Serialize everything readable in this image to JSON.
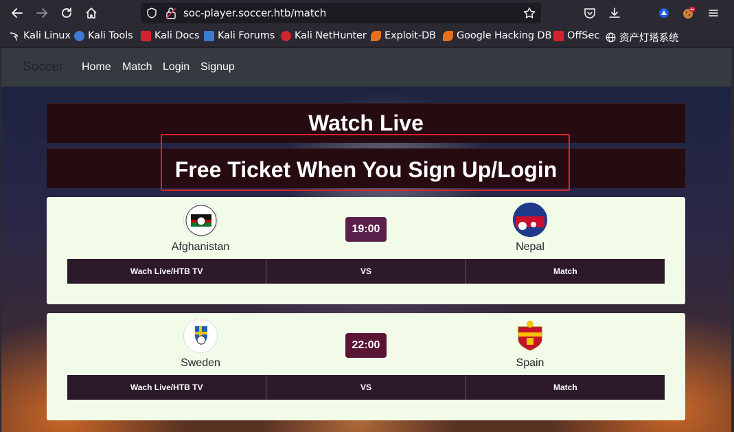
{
  "browser": {
    "url": "soc-player.soccer.htb/match",
    "bookmarks": [
      {
        "label": "Kali Linux",
        "icon": "kali-dragon-icon"
      },
      {
        "label": "Kali Tools",
        "icon": "kali-tools-icon"
      },
      {
        "label": "Kali Docs",
        "icon": "kali-docs-icon"
      },
      {
        "label": "Kali Forums",
        "icon": "kali-forums-icon"
      },
      {
        "label": "Kali NetHunter",
        "icon": "nethunter-icon"
      },
      {
        "label": "Exploit-DB",
        "icon": "exploit-db-icon"
      },
      {
        "label": "Google Hacking DB",
        "icon": "ghdb-icon"
      },
      {
        "label": "OffSec",
        "icon": "offsec-icon"
      },
      {
        "label": "资产灯塔系统",
        "icon": "globe-icon"
      }
    ]
  },
  "navbar": {
    "brand": "Soccer",
    "links": [
      "Home",
      "Match",
      "Login",
      "Signup"
    ]
  },
  "banners": {
    "title": "Watch Live",
    "subtitle": "Free Ticket When You Sign Up/Login"
  },
  "matches": [
    {
      "home": "Afghanistan",
      "away": "Nepal",
      "time": "19:00",
      "time_color": "#5a1f4a",
      "actions": [
        "Wach Live/HTB TV",
        "VS",
        "Match"
      ]
    },
    {
      "home": "Sweden",
      "away": "Spain",
      "time": "22:00",
      "time_color": "#5a1535",
      "actions": [
        "Wach Live/HTB TV",
        "VS",
        "Match"
      ]
    }
  ],
  "colors": {
    "navbar": "#343a40",
    "banner": "#260c10",
    "card": "#f1fbe8",
    "action_bar": "#2c1a2b",
    "highlight_box": "#e0202a"
  }
}
